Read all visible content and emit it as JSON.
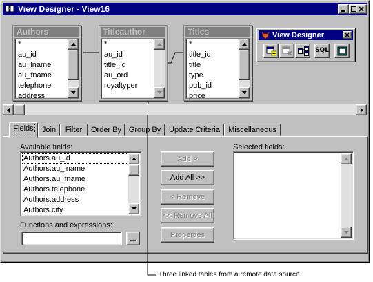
{
  "window": {
    "title": "View Designer - View16"
  },
  "tables": [
    {
      "name": "Authors",
      "fields": [
        "*",
        "au_id",
        "au_lname",
        "au_fname",
        "telephone",
        "address"
      ]
    },
    {
      "name": "Titleauthor",
      "fields": [
        "*",
        "au_id",
        "title_id",
        "au_ord",
        "royaltyper"
      ]
    },
    {
      "name": "Titles",
      "fields": [
        "*",
        "title_id",
        "title",
        "type",
        "pub_id",
        "price"
      ]
    }
  ],
  "toolbar_dialog": {
    "title": "View Designer",
    "tools": [
      "add-table-icon",
      "remove-table-icon",
      "join-icon",
      "sql-icon",
      "output-icon"
    ],
    "sql_label": "SQL"
  },
  "tabs": [
    "Fields",
    "Join",
    "Filter",
    "Order By",
    "Group By",
    "Update Criteria",
    "Miscellaneous"
  ],
  "active_tab": "Fields",
  "fields_tab": {
    "available_label": "Available fields:",
    "available_fields": [
      "Authors.au_id",
      "Authors.au_lname",
      "Authors.au_fname",
      "Authors.telephone",
      "Authors.address",
      "Authors.city"
    ],
    "selected_label": "Selected fields:",
    "functions_label": "Functions and expressions:",
    "functions_value": "",
    "ellipsis_label": "...",
    "buttons": {
      "add": "Add >",
      "add_all": "Add All >>",
      "remove": "< Remove",
      "remove_all": "<< Remove All",
      "properties": "Properties"
    }
  },
  "caption": "Three linked tables from a remote data source."
}
